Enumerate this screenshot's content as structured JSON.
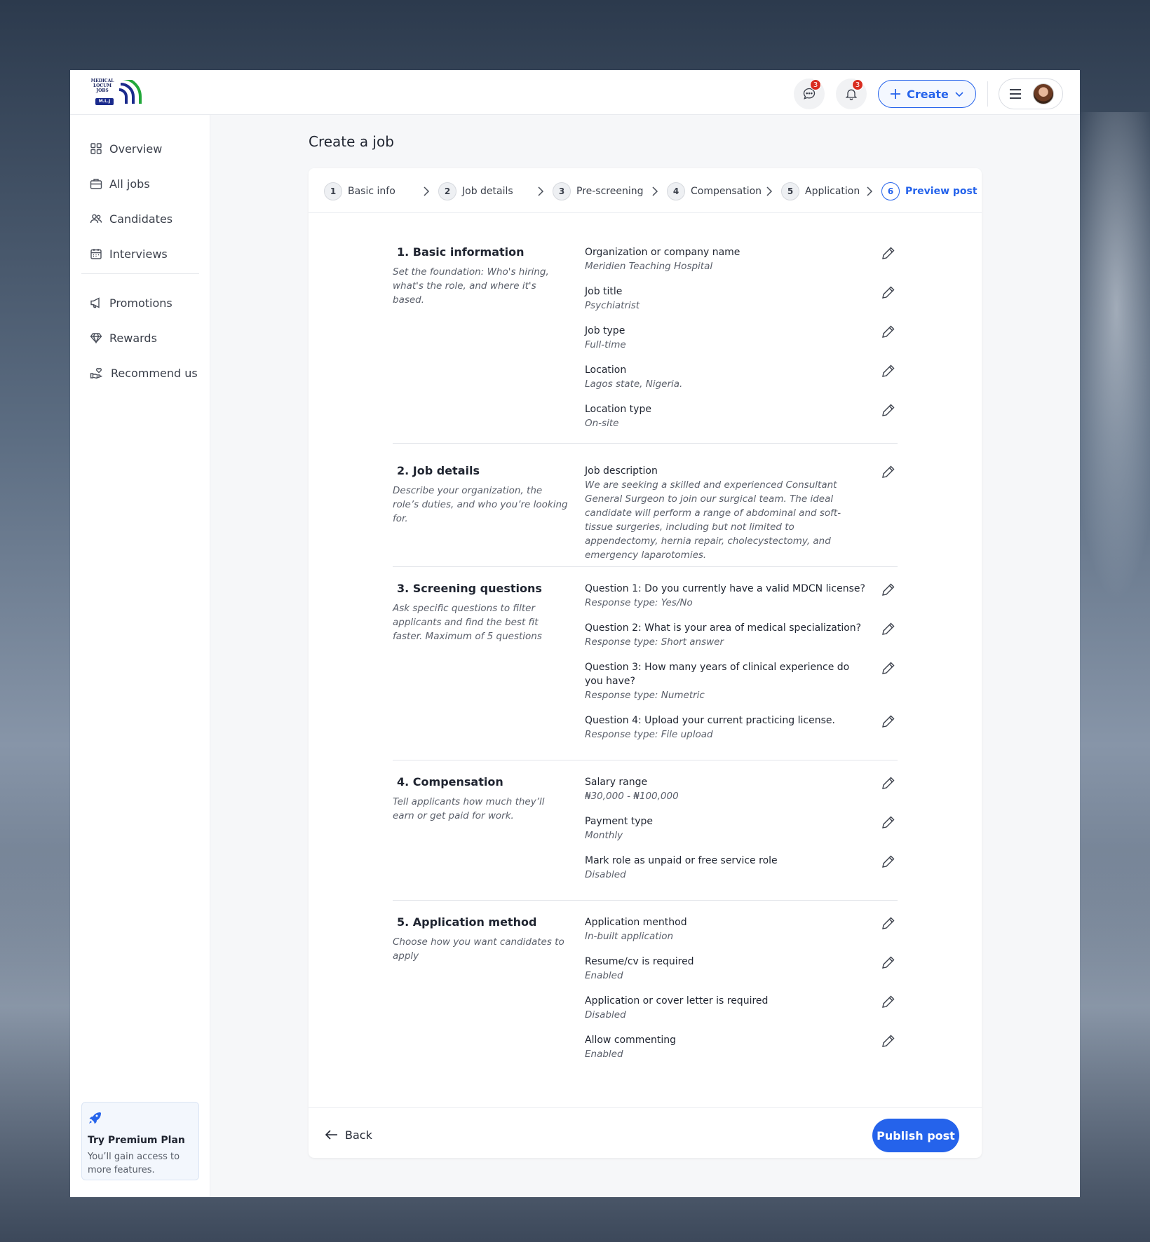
{
  "header": {
    "logo": {
      "lines": [
        "MEDICAL",
        "LOCUM",
        "JOBS"
      ],
      "badge": "M.L.J"
    },
    "messages_badge": "3",
    "notifications_badge": "3",
    "create_label": "Create",
    "accent_color": "#2563eb"
  },
  "sidebar": {
    "items": [
      {
        "label": "Overview",
        "icon": "grid-icon"
      },
      {
        "label": "All jobs",
        "icon": "briefcase-icon"
      },
      {
        "label": "Candidates",
        "icon": "users-icon"
      },
      {
        "label": "Interviews",
        "icon": "calendar-icon"
      },
      {
        "label": "Promotions",
        "icon": "megaphone-icon"
      },
      {
        "label": "Rewards",
        "icon": "diamond-icon"
      },
      {
        "label": "Recommend us",
        "icon": "hand-heart-icon"
      }
    ],
    "premium": {
      "title": "Try Premium Plan",
      "subtitle": "You’ll gain access to more features."
    }
  },
  "page": {
    "title": "Create a job"
  },
  "stepper": [
    {
      "num": "1",
      "label": "Basic info"
    },
    {
      "num": "2",
      "label": "Job details"
    },
    {
      "num": "3",
      "label": "Pre-screening"
    },
    {
      "num": "4",
      "label": "Compensation"
    },
    {
      "num": "5",
      "label": "Application"
    },
    {
      "num": "6",
      "label": "Preview post"
    }
  ],
  "sections": [
    {
      "title": "1. Basic information",
      "description": "Set the foundation: Who's hiring, what's the role, and where it's based.",
      "fields": [
        {
          "label": "Organization or company name",
          "value": "Meridien Teaching Hospital"
        },
        {
          "label": "Job title",
          "value": "Psychiatrist"
        },
        {
          "label": "Job type",
          "value": "Full-time"
        },
        {
          "label": "Location",
          "value": "Lagos state, Nigeria."
        },
        {
          "label": "Location type",
          "value": "On-site"
        }
      ]
    },
    {
      "title": "2. Job details",
      "description": "Describe your organization, the role’s duties, and who you’re looking for.",
      "fields": [
        {
          "label": "Job description",
          "value": "We are seeking a skilled and experienced Consultant General Surgeon to join our surgical team. The ideal candidate will perform a range of abdominal and soft-tissue surgeries, including but not limited to appendectomy, hernia repair, cholecystectomy, and emergency laparotomies."
        }
      ]
    },
    {
      "title": "3. Screening questions",
      "description": "Ask specific questions to filter applicants and find the best fit faster. Maximum of 5 questions",
      "fields": [
        {
          "label": "Question 1: Do you currently have a valid MDCN license?",
          "value": "Response type: Yes/No"
        },
        {
          "label": "Question 2: What is your area of medical specialization?",
          "value": "Response type: Short answer"
        },
        {
          "label": "Question 3: How many years of clinical experience do you have?",
          "value": "Response type: Numetric"
        },
        {
          "label": "Question 4: Upload your current practicing license.",
          "value": "Response type: File upload"
        }
      ]
    },
    {
      "title": "4. Compensation",
      "description": "Tell applicants how much they’ll earn or get paid for work.",
      "fields": [
        {
          "label": "Salary range",
          "value": "₦30,000 - ₦100,000"
        },
        {
          "label": "Payment type",
          "value": "Monthly"
        },
        {
          "label": "Mark role as unpaid or free service role",
          "value": "Disabled"
        }
      ]
    },
    {
      "title": "5. Application method",
      "description": "Choose how you want candidates to apply",
      "fields": [
        {
          "label": "Application menthod",
          "value": "In-built application"
        },
        {
          "label": "Resume/cv is required",
          "value": "Enabled"
        },
        {
          "label": "Application or cover letter is required",
          "value": "Disabled"
        },
        {
          "label": "Allow commenting",
          "value": "Enabled"
        }
      ]
    }
  ],
  "footer": {
    "back_label": "Back",
    "publish_label": "Publish post"
  }
}
